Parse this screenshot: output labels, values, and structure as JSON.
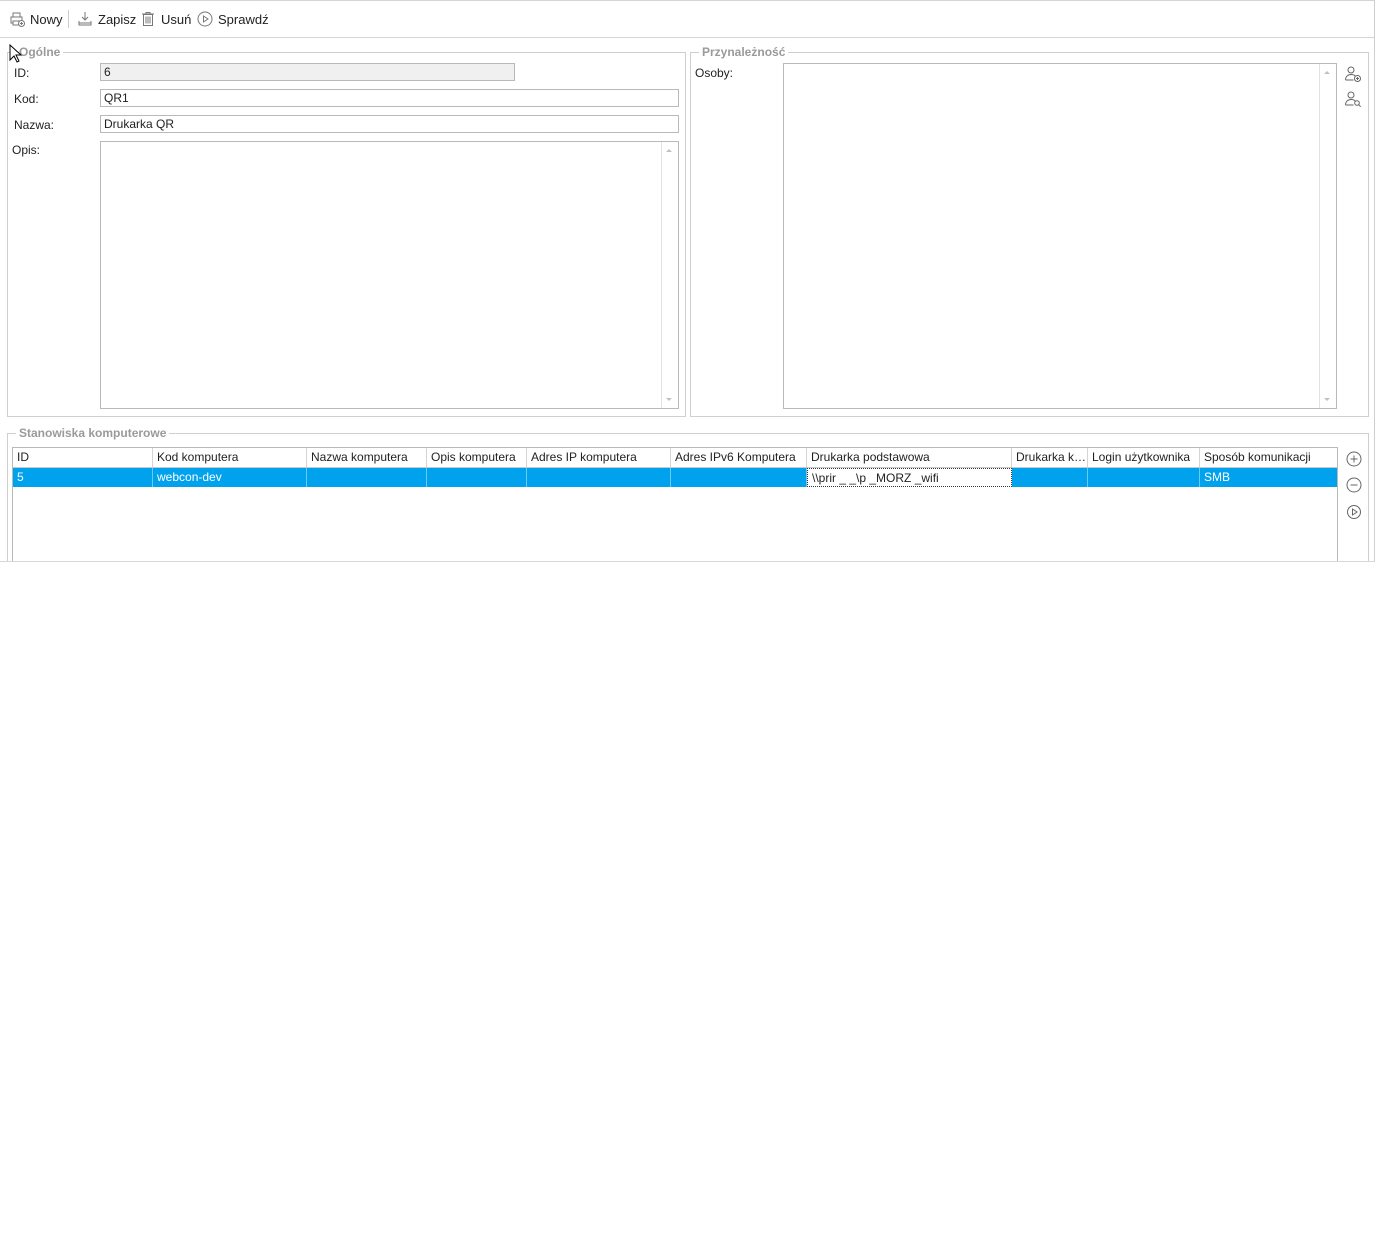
{
  "toolbar": {
    "new_label": "Nowy",
    "save_label": "Zapisz",
    "delete_label": "Usuń",
    "check_label": "Sprawdź"
  },
  "general": {
    "legend": "Ogólne",
    "id_label": "ID:",
    "id_value": "6",
    "code_label": "Kod:",
    "code_value": "QR1",
    "name_label": "Nazwa:",
    "name_value": "Drukarka QR",
    "desc_label": "Opis:",
    "desc_value": ""
  },
  "membership": {
    "legend": "Przynależność",
    "persons_label": "Osoby:"
  },
  "workstations": {
    "legend": "Stanowiska komputerowe",
    "columns": [
      "ID",
      "Kod komputera",
      "Nazwa komputera",
      "Opis komputera",
      "Adres IP komputera",
      "Adres IPv6 Komputera",
      "Drukarka podstawowa",
      "Drukarka ks...",
      "Login użytkownika",
      "Sposób komunikacji"
    ],
    "rows": [
      [
        "5",
        "webcon-dev",
        "",
        "",
        "",
        "",
        "\\\\prir     _ _\\p      _MORZ    _wifi",
        "",
        "",
        "SMB"
      ]
    ]
  },
  "icons": {
    "add_person": "add-person-icon",
    "find_person": "find-person-icon",
    "add_row": "plus-circle-icon",
    "remove_row": "minus-circle-icon",
    "run_row": "play-circle-icon"
  },
  "colors": {
    "selection": "#00a2ed",
    "legend_text": "#9a9a9a"
  }
}
